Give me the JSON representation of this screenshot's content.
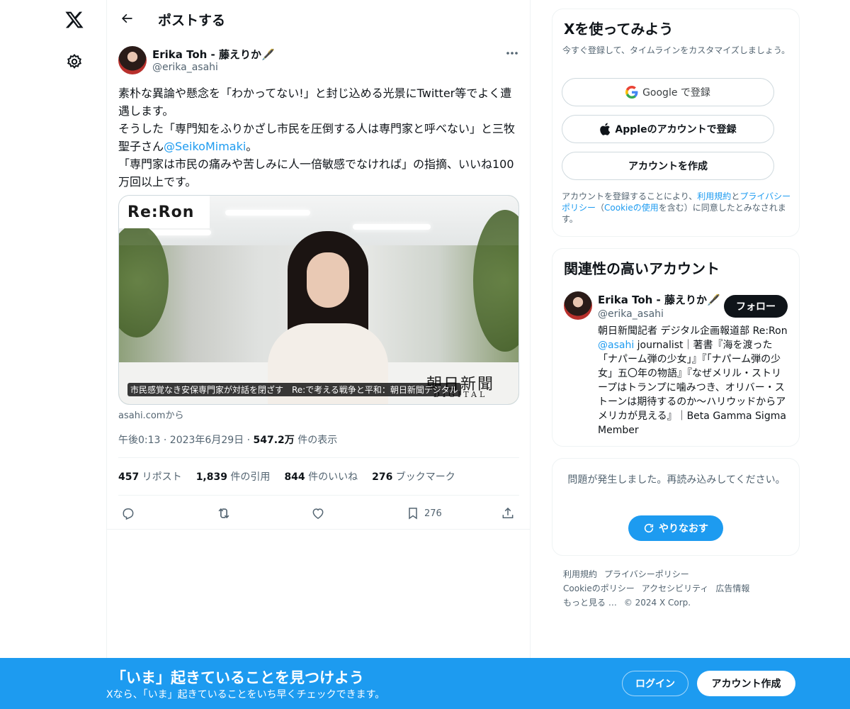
{
  "nav": {
    "logo_icon": "x-logo-icon",
    "settings_icon": "gear-icon"
  },
  "header": {
    "title": "ポストする",
    "back_icon": "arrow-left-icon"
  },
  "post": {
    "author_name": "Erika Toh - 藤えりか🖋️",
    "author_handle": "@erika_asahi",
    "text_1": "素朴な異論や懸念を「わかってない!」と封じ込める光景にTwitter等でよく遭遇します。",
    "text_2a": "そうした「専門知をふりかざし市民を圧倒する人は専門家と呼べない」と三牧聖子さん",
    "text_2_mention": "@SeikoMimaki",
    "text_2b": "。",
    "text_3": "「専門家は市民の痛みや苦しみに人一倍敏感でなければ」の指摘、いいね100万回以上です。",
    "card": {
      "logo": "Re:Ron",
      "brand": "朝日新聞",
      "brand_sub": "DIGITAL",
      "caption": "市民感覚なき安保専門家が対話を閉ざす　Re:で考える戦争と平和：朝日新聞デジタル",
      "source": "asahi.comから"
    },
    "meta": {
      "time": "午後0:13 · 2023年6月29日 · ",
      "views": "547.2万",
      "views_label": " 件の表示"
    },
    "stats": {
      "reposts": "457",
      "reposts_label": " リポスト",
      "quotes": "1,839",
      "quotes_label": " 件の引用",
      "likes": "844",
      "likes_label": " 件のいいね",
      "bookmarks": "276",
      "bookmarks_label": " ブックマーク"
    },
    "actions": {
      "bookmark_count": "276"
    }
  },
  "signup": {
    "title": "Xを使ってみよう",
    "subtitle": "今すぐ登録して、タイムラインをカスタマイズしましょう。",
    "google_label": "Google で登録",
    "apple_label": "Appleのアカウントで登録",
    "create_label": "アカウントを作成",
    "terms_1": "アカウントを登録することにより、",
    "terms_tos": "利用規約",
    "terms_2": "と",
    "terms_privacy": "プライバシーポリシー",
    "terms_3": "（",
    "terms_cookie": "Cookieの使用",
    "terms_4": "を含む）に同意したとみなされます。"
  },
  "relevant": {
    "title": "関連性の高いアカウント",
    "name": "Erika Toh - 藤えりか🖋️",
    "handle": "@erika_asahi",
    "follow_label": "フォロー",
    "bio_1": "朝日新聞記者 デジタル企画報道部 Re:Ron ",
    "bio_mention": "@asahi",
    "bio_2": " journalist｜著書『海を渡った「ナパーム弾の少女」』『「ナパーム弾の少女」五〇年の物語』『なぜメリル・ストリープはトランプに噛みつき、オリバー・ストーンは期待するのか〜ハリウッドからアメリカが見える』｜Beta Gamma Sigma Member"
  },
  "error": {
    "message": "問題が発生しました。再読み込みしてください。",
    "retry_label": "やりなおす"
  },
  "footer": {
    "links": [
      "利用規約",
      "プライバシーポリシー",
      "Cookieのポリシー",
      "アクセシビリティ",
      "広告情報",
      "もっと見る …",
      "© 2024 X Corp."
    ]
  },
  "banner": {
    "title": "「いま」起きていることを見つけよう",
    "subtitle": "Xなら、「いま」起きていることをいち早くチェックできます。",
    "login_label": "ログイン",
    "signup_label": "アカウント作成"
  },
  "colors": {
    "accent": "#1d9bf0",
    "text": "#0f1419",
    "muted": "#536471",
    "border": "#eff3f4"
  }
}
